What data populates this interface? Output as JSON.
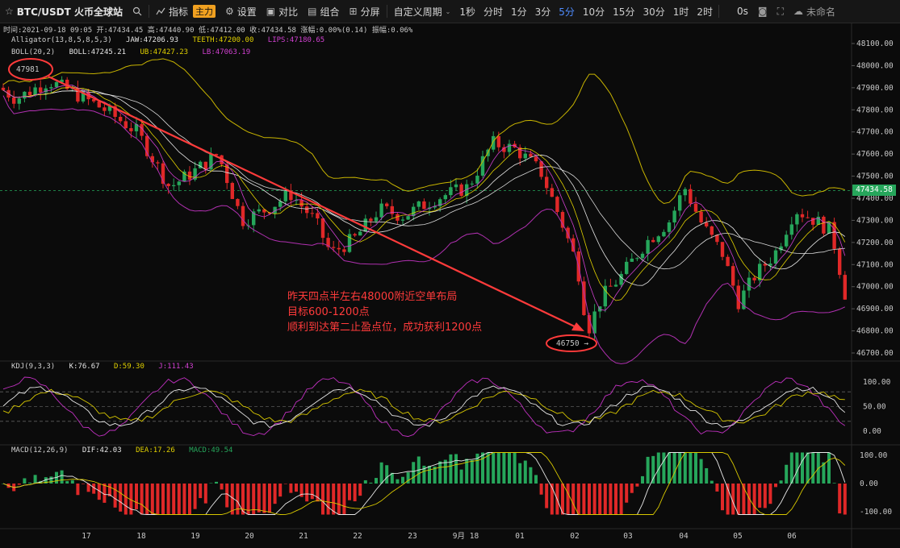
{
  "toolbar": {
    "symbol": "BTC/USDT 火币全球站",
    "indicators": "指标",
    "indicators_badge": "主力",
    "settings": "设置",
    "compare": "对比",
    "combine": "组合",
    "split": "分屏",
    "custom_period": "自定义周期",
    "periods": [
      "1秒",
      "分时",
      "1分",
      "3分",
      "5分",
      "10分",
      "15分",
      "30分",
      "1时",
      "2时"
    ],
    "active_period": "5分",
    "interval": "0s",
    "layout_name": "未命名"
  },
  "info": {
    "time": "时间:2021-09-18 09:05",
    "open": "开:47434.45",
    "high": "高:47440.90",
    "low": "低:47412.00",
    "close": "收:47434.58",
    "change": "涨幅:0.00%(0.14)",
    "amplitude": "振幅:0.06%"
  },
  "alligator": {
    "label": "Alligator(13,8,5,8,5,3)",
    "jaw": "JAW:47206.93",
    "teeth": "TEETH:47200.00",
    "lips": "LIPS:47180.65"
  },
  "boll": {
    "label": "BOLL(20,2)",
    "boll": "BOLL:47245.21",
    "ub": "UB:47427.23",
    "lb": "LB:47063.19"
  },
  "kdj": {
    "label": "KDJ(9,3,3)",
    "k": "K:76.67",
    "d": "D:59.30",
    "j": "J:111.43"
  },
  "macd": {
    "label": "MACD(12,26,9)",
    "dif": "DIF:42.03",
    "dea": "DEA:17.26",
    "macd": "MACD:49.54"
  },
  "price_axis": [
    "48100.00",
    "48000.00",
    "47900.00",
    "47800.00",
    "47700.00",
    "47600.00",
    "47500.00",
    "47400.00",
    "47300.00",
    "47200.00",
    "47100.00",
    "47000.00",
    "46900.00",
    "46800.00",
    "46700.00"
  ],
  "current_price": "47434.58",
  "kdj_axis": [
    "100.00",
    "50.00",
    "0.00"
  ],
  "macd_axis": [
    "100.00",
    "0.00",
    "-100.00"
  ],
  "time_axis": [
    "17",
    "18",
    "19",
    "20",
    "21",
    "22",
    "23",
    "9月 18",
    "01",
    "02",
    "03",
    "04",
    "05",
    "06"
  ],
  "annotation": {
    "high_mark": "47981",
    "low_mark": "46750",
    "line1": "昨天四点半左右48000附近空单布局",
    "line2": "目标600-1200点",
    "line3": "顺利到达第二止盈点位，成功获利1200点"
  },
  "colors": {
    "up": "#26a65b",
    "down": "#e02828",
    "annotation": "#ff3b3b",
    "active_period": "#4f8cff",
    "badge": "#f0a020"
  }
}
